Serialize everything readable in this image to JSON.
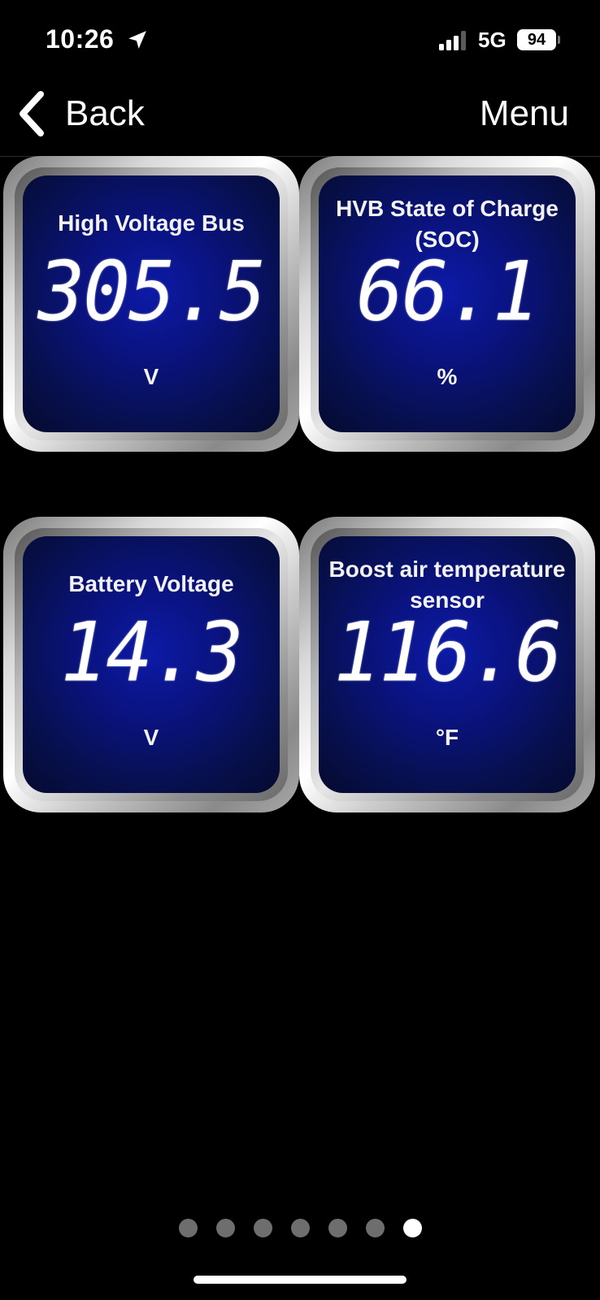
{
  "status_bar": {
    "time": "10:26",
    "network": "5G",
    "battery": "94"
  },
  "nav": {
    "back_label": "Back",
    "menu_label": "Menu"
  },
  "gauges": [
    {
      "title": "High Voltage Bus",
      "value": "305.5",
      "unit": "V"
    },
    {
      "title": "HVB State of Charge\n(SOC)",
      "value": "66.1",
      "unit": "%"
    },
    {
      "title": "Battery Voltage",
      "value": "14.3",
      "unit": "V"
    },
    {
      "title": "Boost air temperature\nsensor",
      "value": "116.6",
      "unit": "°F"
    }
  ],
  "pagination": {
    "total": 7,
    "active_index": 6
  }
}
